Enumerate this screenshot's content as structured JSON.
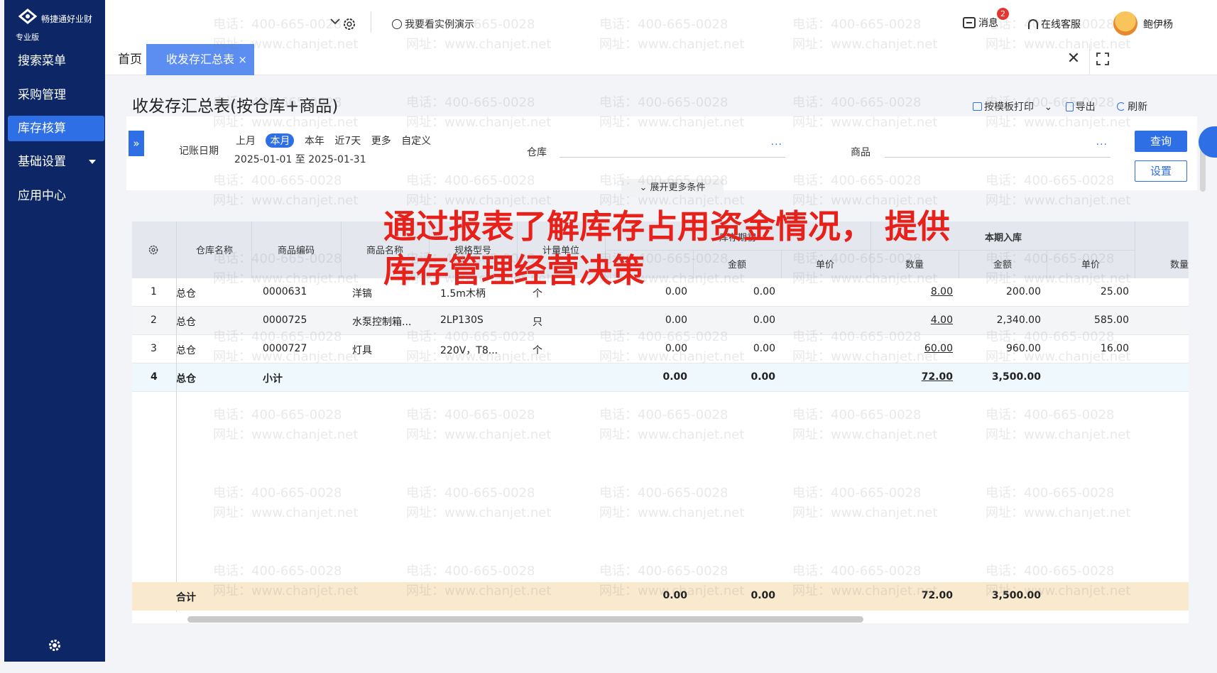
{
  "brand": {
    "name": "畅捷通好业财",
    "edition": "专业版"
  },
  "sidebar": {
    "items": [
      {
        "label": "搜索菜单",
        "active": false
      },
      {
        "label": "采购管理",
        "active": false
      },
      {
        "label": "库存核算",
        "active": true
      },
      {
        "label": "基础设置",
        "active": false
      },
      {
        "label": "应用中心",
        "active": false
      }
    ]
  },
  "topbar": {
    "account_placeholder": "",
    "demo_label": "我要看实例演示",
    "message_label": "消息",
    "message_badge": "2",
    "service_label": "在线客服",
    "user_name": "鲍伊杨"
  },
  "tabs": {
    "home": "首页",
    "active": "收发存汇总表",
    "close": "×"
  },
  "report": {
    "title": "收发存汇总表(按仓库+商品)",
    "print_label": "按模板打印",
    "export_label": "导出",
    "refresh_label": "刷新"
  },
  "filters": {
    "date_label": "记账日期",
    "date_options": [
      "上月",
      "本月",
      "本年",
      "近7天",
      "更多",
      "自定义"
    ],
    "date_selected": "本月",
    "date_range": "2025-01-01 至 2025-01-31",
    "warehouse_label": "仓库",
    "product_label": "商品",
    "dots": "···",
    "query_label": "查询",
    "settings_label": "设置",
    "more_conditions": "展开更多条件"
  },
  "table": {
    "headers": {
      "warehouse": "仓库名称",
      "code": "商品编码",
      "name": "商品名称",
      "spec": "规格型号",
      "unit": "计量单位",
      "group_opening": "库存期初",
      "group_in": "本期入库",
      "amount": "金额",
      "price": "单价",
      "qty": "数量",
      "qty_cut": "数量"
    },
    "rows": [
      {
        "no": "1",
        "warehouse": "总仓",
        "code": "0000631",
        "name": "洋镐",
        "spec": "1.5m木柄",
        "unit": "个",
        "open_qty": "0.00",
        "open_amt": "0.00",
        "in_qty": "8.00",
        "in_amt": "200.00",
        "in_price": "25.00"
      },
      {
        "no": "2",
        "warehouse": "总仓",
        "code": "0000725",
        "name": "水泵控制箱...",
        "spec": "2LP130S",
        "unit": "只",
        "open_qty": "0.00",
        "open_amt": "0.00",
        "in_qty": "4.00",
        "in_amt": "2,340.00",
        "in_price": "585.00"
      },
      {
        "no": "3",
        "warehouse": "总仓",
        "code": "0000727",
        "name": "灯具",
        "spec": "220V，T8...",
        "unit": "个",
        "open_qty": "0.00",
        "open_amt": "0.00",
        "in_qty": "60.00",
        "in_amt": "960.00",
        "in_price": "16.00"
      }
    ],
    "subtotal": {
      "no": "4",
      "warehouse": "总仓",
      "code": "小计",
      "open_qty": "0.00",
      "open_amt": "0.00",
      "in_qty": "72.00",
      "in_amt": "3,500.00"
    },
    "total": {
      "label": "合计",
      "open_qty": "0.00",
      "open_amt": "0.00",
      "in_qty": "72.00",
      "in_amt": "3,500.00"
    }
  },
  "overlay": {
    "line1": "通过报表了解库存占用资金情况， 提供",
    "line2": "库存管理经营决策"
  },
  "watermark": {
    "phone": "电话：400-665-0028",
    "site": "网址：www.chanjet.net"
  }
}
